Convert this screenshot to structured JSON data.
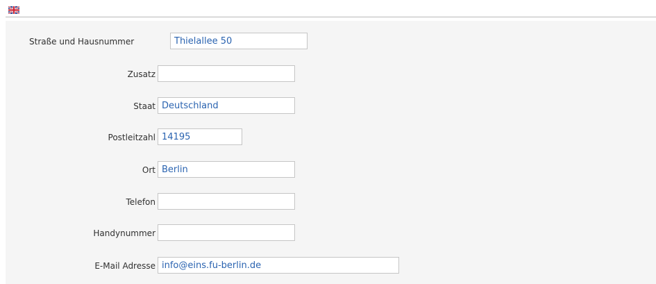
{
  "header": {
    "language_icon": "uk-flag-icon"
  },
  "form": {
    "strasse": {
      "label": "Straße und Hausnummer",
      "value": "Thielallee 50"
    },
    "zusatz": {
      "label": "Zusatz",
      "value": ""
    },
    "staat": {
      "label": "Staat",
      "value": "Deutschland"
    },
    "plz": {
      "label": "Postleitzahl",
      "value": "14195"
    },
    "ort": {
      "label": "Ort",
      "value": "Berlin"
    },
    "telefon": {
      "label": "Telefon",
      "value": ""
    },
    "handy": {
      "label": "Handynummer",
      "value": ""
    },
    "email": {
      "label": "E-Mail Adresse",
      "value": "info@eins.fu-berlin.de"
    }
  },
  "colors": {
    "value_text": "#2a63b0",
    "form_background": "#f5f5f5"
  }
}
